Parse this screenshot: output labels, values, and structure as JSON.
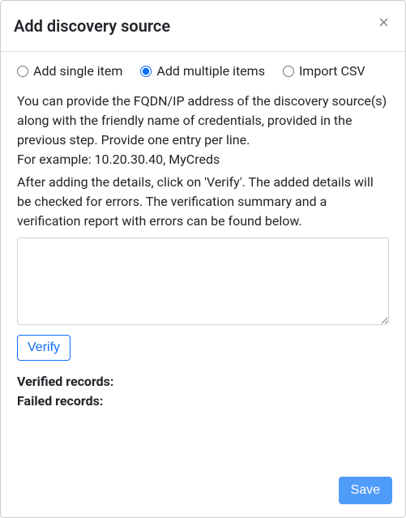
{
  "header": {
    "title": "Add discovery source",
    "close_label": "×"
  },
  "mode": {
    "selected": "multiple",
    "options": {
      "single": "Add single item",
      "multiple": "Add multiple items",
      "import": "Import CSV"
    }
  },
  "instructions": {
    "para1": "You can provide the FQDN/IP address of the discovery source(s) along with the friendly name of credentials, provided in the previous step. Provide one entry per line.",
    "example": "For example: 10.20.30.40, MyCreds",
    "para2": "After adding the details, click on 'Verify'. The added details will be checked for errors. The verification summary and a verification report with errors can be found below."
  },
  "entries": {
    "value": ""
  },
  "buttons": {
    "verify": "Verify",
    "save": "Save"
  },
  "summary": {
    "verified_label": "Verified records:",
    "failed_label": "Failed records:"
  }
}
